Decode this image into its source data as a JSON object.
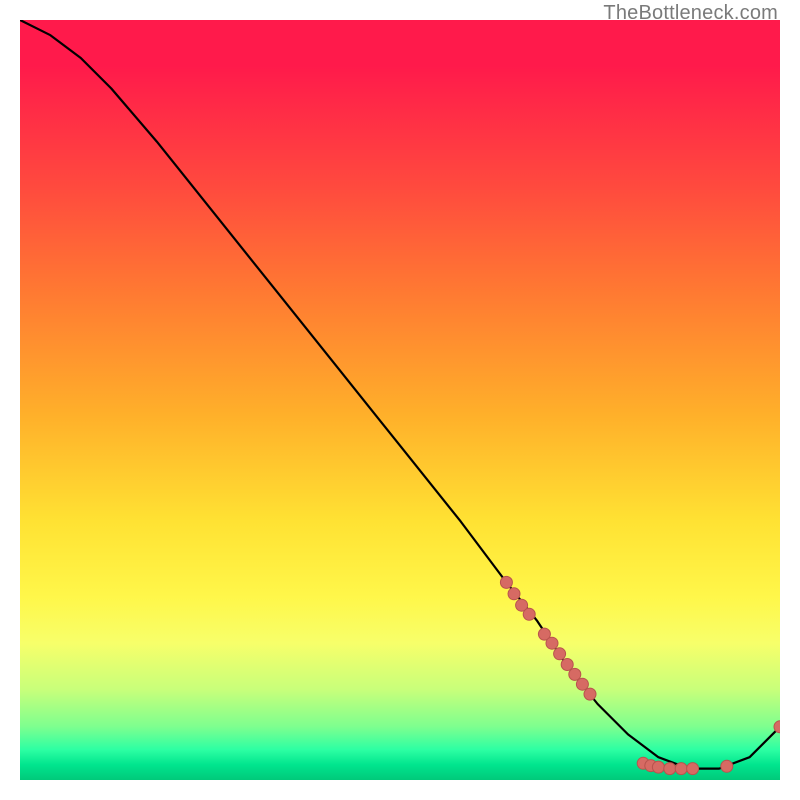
{
  "watermark": "TheBottleneck.com",
  "colors": {
    "curve": "#000000",
    "marker_fill": "#d66a63",
    "marker_stroke": "#b8534d"
  },
  "chart_data": {
    "type": "line",
    "title": "",
    "xlabel": "",
    "ylabel": "",
    "xlim": [
      0,
      100
    ],
    "ylim": [
      0,
      100
    ],
    "legend": false,
    "grid": false,
    "series": [
      {
        "name": "bottleneck-curve",
        "x": [
          0,
          4,
          8,
          12,
          18,
          26,
          34,
          42,
          50,
          58,
          64,
          68,
          72,
          76,
          80,
          84,
          88,
          92,
          96,
          100
        ],
        "y": [
          100,
          98,
          95,
          91,
          84,
          74,
          64,
          54,
          44,
          34,
          26,
          21,
          15,
          10,
          6,
          3,
          1.5,
          1.5,
          3,
          7
        ]
      }
    ],
    "markers": [
      {
        "name": "highlighted-points",
        "points": [
          {
            "x": 64,
            "y": 26
          },
          {
            "x": 65,
            "y": 24.5
          },
          {
            "x": 66,
            "y": 23
          },
          {
            "x": 67,
            "y": 21.8
          },
          {
            "x": 69,
            "y": 19.2
          },
          {
            "x": 70,
            "y": 18
          },
          {
            "x": 71,
            "y": 16.6
          },
          {
            "x": 72,
            "y": 15.2
          },
          {
            "x": 73,
            "y": 13.9
          },
          {
            "x": 74,
            "y": 12.6
          },
          {
            "x": 75,
            "y": 11.3
          },
          {
            "x": 82,
            "y": 2.2
          },
          {
            "x": 83,
            "y": 1.9
          },
          {
            "x": 84,
            "y": 1.7
          },
          {
            "x": 85.5,
            "y": 1.5
          },
          {
            "x": 87,
            "y": 1.5
          },
          {
            "x": 88.5,
            "y": 1.5
          },
          {
            "x": 93,
            "y": 1.8
          },
          {
            "x": 100,
            "y": 7
          }
        ]
      }
    ]
  }
}
